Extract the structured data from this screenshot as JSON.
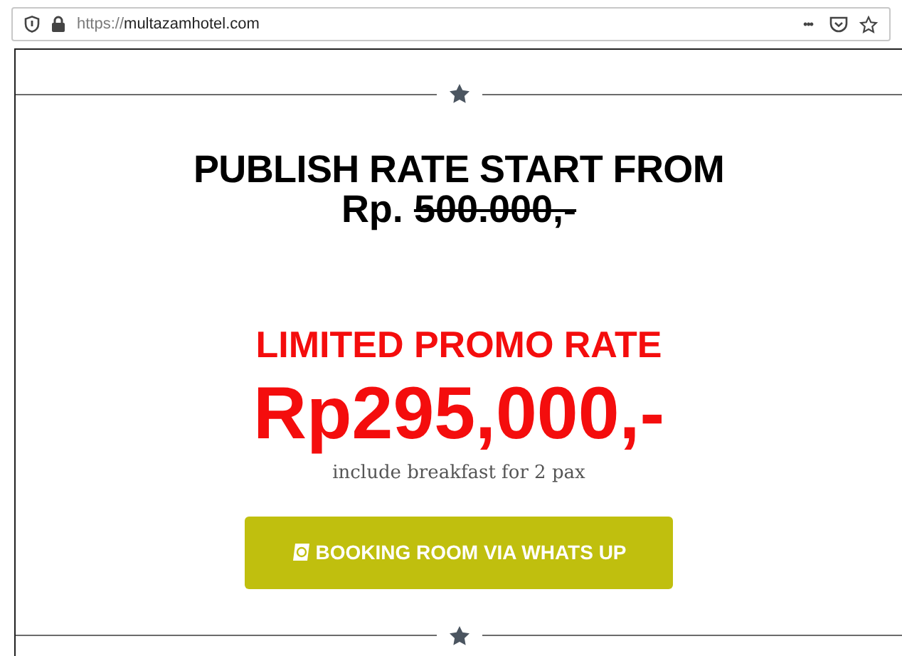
{
  "browser": {
    "url_scheme": "https://",
    "url_host": "multazamhotel.com",
    "menu": "•••"
  },
  "publish": {
    "title": "PUBLISH RATE START FROM",
    "prefix": "Rp.",
    "old_price": "500.000,-"
  },
  "promo": {
    "title": "LIMITED PROMO RATE",
    "price": "Rp295,000,-",
    "note": "include breakfast for 2 pax"
  },
  "booking_button": {
    "label": "BOOKING ROOM VIA WHATS UP"
  }
}
